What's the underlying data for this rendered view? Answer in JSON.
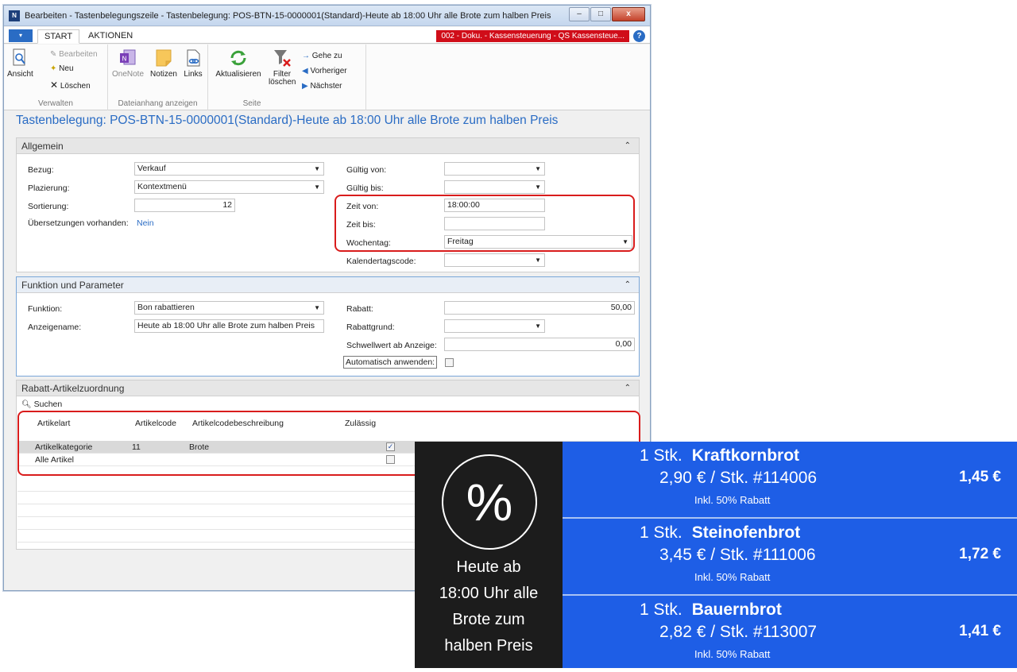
{
  "window": {
    "title": "Bearbeiten - Tastenbelegungszeile - Tastenbelegung: POS-BTN-15-0000001(Standard)-Heute ab 18:00 Uhr alle Brote zum halben Preis",
    "minimize": "–",
    "maximize": "□",
    "close": "x"
  },
  "tabs": {
    "menu": "▾",
    "start": "START",
    "actions": "AKTIONEN"
  },
  "company": "002 - Doku. - Kassensteuerung - QS Kassensteue...",
  "ribbon": {
    "ansicht": "Ansicht",
    "bearbeiten": "Bearbeiten",
    "neu": "Neu",
    "loeschen": "Löschen",
    "group_verwalten": "Verwalten",
    "onenote": "OneNote",
    "notizen": "Notizen",
    "links": "Links",
    "group_dateianhang": "Dateianhang anzeigen",
    "aktualisieren": "Aktualisieren",
    "filter_line1": "Filter",
    "filter_line2": "löschen",
    "gehe_zu": "Gehe zu",
    "vorheriger": "Vorheriger",
    "naechster": "Nächster",
    "group_seite": "Seite"
  },
  "page_title": "Tastenbelegung: POS-BTN-15-0000001(Standard)-Heute ab 18:00 Uhr alle Brote zum halben Preis",
  "allgemein": {
    "header": "Allgemein",
    "bezug_label": "Bezug:",
    "bezug_value": "Verkauf",
    "plazierung_label": "Plazierung:",
    "plazierung_value": "Kontextmenü",
    "sortierung_label": "Sortierung:",
    "sortierung_value": "12",
    "uebersetzungen_label": "Übersetzungen vorhanden:",
    "uebersetzungen_value": "Nein",
    "gueltig_von_label": "Gültig von:",
    "gueltig_von_value": "",
    "gueltig_bis_label": "Gültig bis:",
    "gueltig_bis_value": "",
    "zeit_von_label": "Zeit von:",
    "zeit_von_value": "18:00:00",
    "zeit_bis_label": "Zeit bis:",
    "zeit_bis_value": "",
    "wochentag_label": "Wochentag:",
    "wochentag_value": "Freitag",
    "kalendertag_label": "Kalendertagscode:",
    "kalendertag_value": ""
  },
  "funktion": {
    "header": "Funktion und Parameter",
    "funktion_label": "Funktion:",
    "funktion_value": "Bon rabattieren",
    "anzeigename_label": "Anzeigename:",
    "anzeigename_value": "Heute ab 18:00 Uhr alle Brote zum halben Preis",
    "rabatt_label": "Rabatt:",
    "rabatt_value": "50,00",
    "rabattgrund_label": "Rabattgrund:",
    "rabattgrund_value": "",
    "schwellwert_label": "Schwellwert ab Anzeige:",
    "schwellwert_value": "0,00",
    "automatisch_label": "Automatisch anwenden:"
  },
  "zuordnung": {
    "header": "Rabatt-Artikelzuordnung",
    "suchen": "Suchen",
    "columns": [
      "Artikelart",
      "Artikelcode",
      "Artikelcodebeschreibung",
      "Zulässig"
    ],
    "rows": [
      {
        "artikelart": "Artikelkategorie",
        "artikelcode": "11",
        "beschreibung": "Brote",
        "zulaessig": "✓"
      },
      {
        "artikelart": "Alle Artikel",
        "artikelcode": "",
        "beschreibung": "",
        "zulaessig": ""
      }
    ]
  },
  "pos": {
    "symbol": "%",
    "text_lines": [
      "Heute ab",
      "18:00 Uhr alle",
      "Brote zum",
      "halben Preis"
    ],
    "items": [
      {
        "qty": "1 Stk.",
        "name": "Kraftkornbrot",
        "price": "2,90 € / Stk.  #114006",
        "discount": "Inkl. 50% Rabatt",
        "total": "1,45 €"
      },
      {
        "qty": "1 Stk.",
        "name": "Steinofenbrot",
        "price": "3,45 € / Stk.  #111006",
        "discount": "Inkl. 50% Rabatt",
        "total": "1,72 €"
      },
      {
        "qty": "1 Stk.",
        "name": "Bauernbrot",
        "price": "2,82 € / Stk.  #113007",
        "discount": "Inkl. 50% Rabatt",
        "total": "1,41 €"
      }
    ]
  },
  "colors": {
    "accent": "#2a6cc4",
    "highlight": "#d91c1c",
    "pos_blue": "#1e5ee6",
    "pos_dark": "#1c1c1c"
  }
}
